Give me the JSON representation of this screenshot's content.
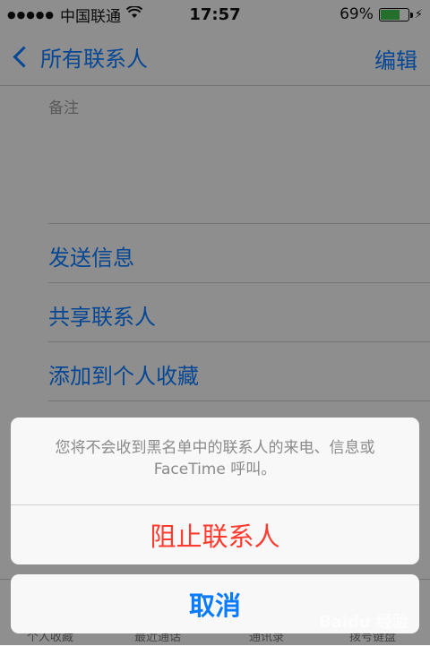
{
  "status_bar": {
    "signal": "●●●●●",
    "carrier": "中国联通",
    "time": "17:57",
    "battery_percent": "69%",
    "battery_level": 0.69,
    "battery_color": "#3fbf4a"
  },
  "nav": {
    "back_label": "所有联系人",
    "edit_label": "编辑"
  },
  "content": {
    "notes_label": "备注",
    "rows": [
      "发送信息",
      "共享联系人",
      "添加到个人收藏"
    ]
  },
  "tab_bar": {
    "items": [
      "个人收藏",
      "最近通话",
      "通讯录",
      "拨号键盘"
    ]
  },
  "action_sheet": {
    "message": "您将不会收到黑名单中的联系人的来电、信息或 FaceTime 呼叫。",
    "destructive_label": "阻止联系人",
    "cancel_label": "取消"
  },
  "colors": {
    "accent": "#0a7aff",
    "destructive": "#ff3b30"
  },
  "watermark": "Baidu 经验"
}
